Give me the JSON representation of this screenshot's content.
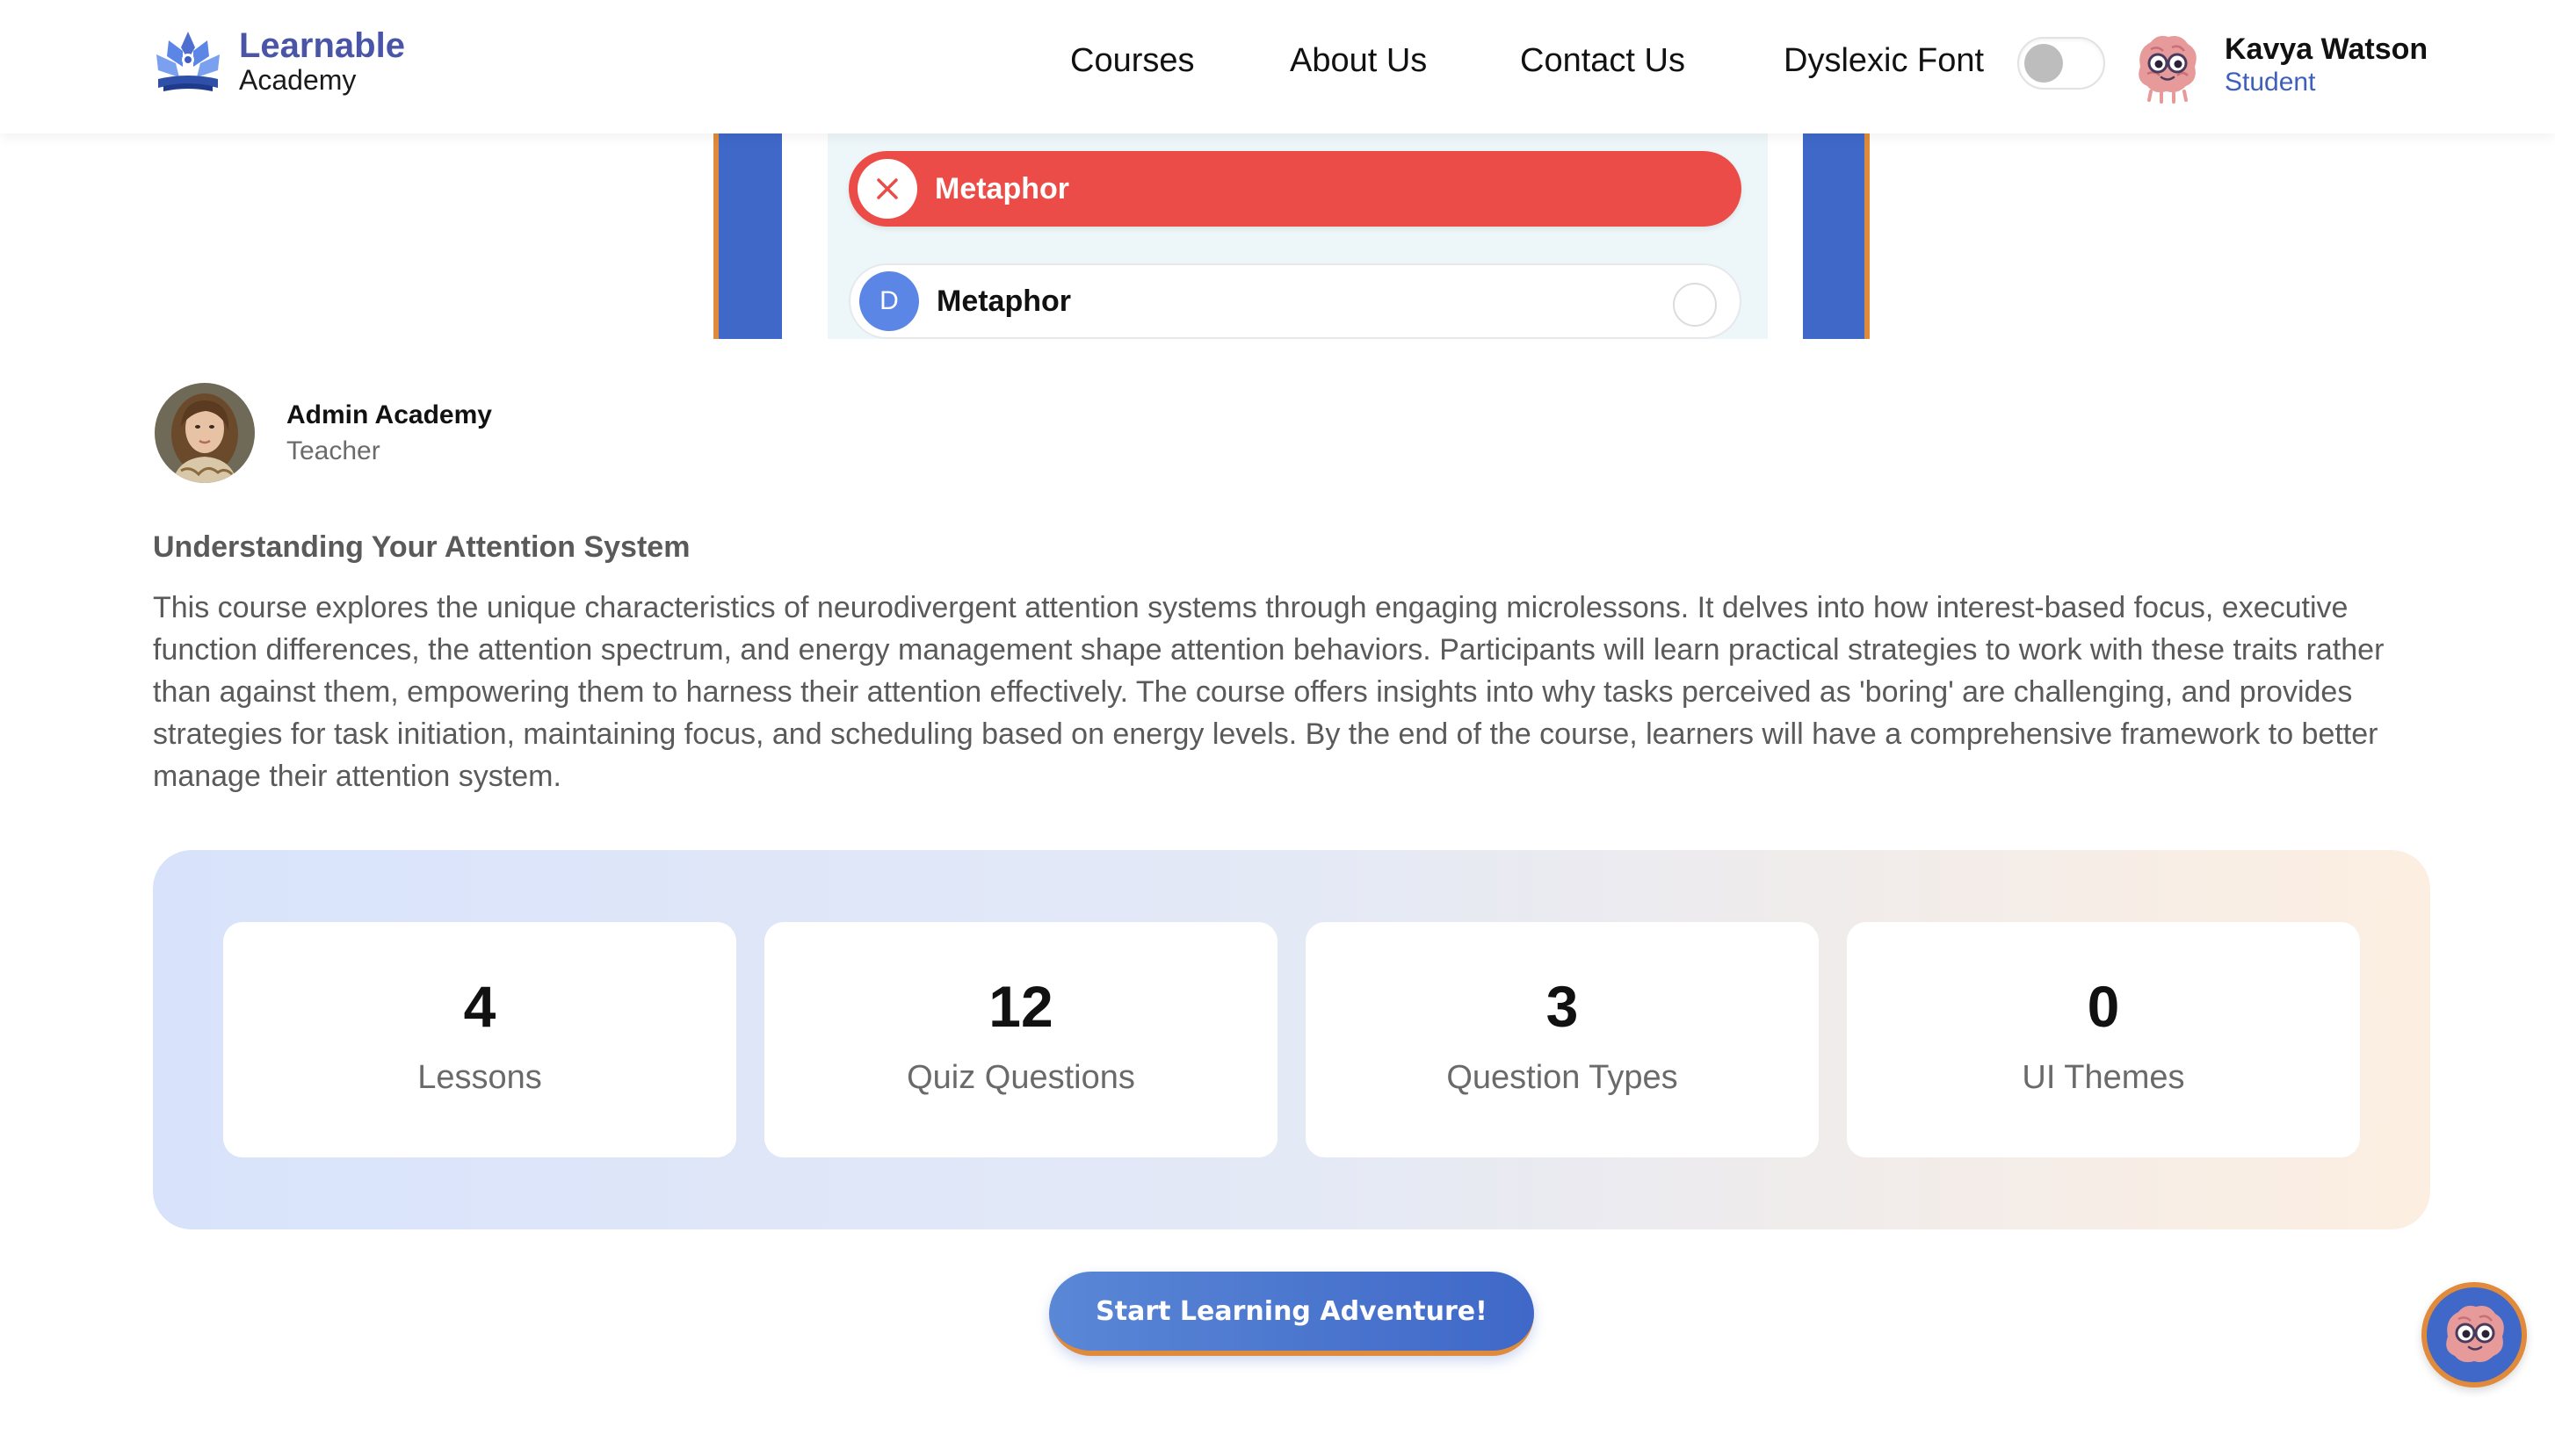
{
  "brand": {
    "name": "Learnable",
    "sub": "Academy"
  },
  "nav": {
    "courses": "Courses",
    "about": "About Us",
    "contact": "Contact Us",
    "dyslexic_font": "Dyslexic Font"
  },
  "user": {
    "name": "Kavya Watson",
    "role": "Student"
  },
  "preview": {
    "options": [
      {
        "badge": "✕",
        "text": "Metaphor",
        "state": "wrong"
      },
      {
        "badge": "D",
        "text": "Metaphor",
        "state": "unselected"
      }
    ]
  },
  "teacher": {
    "name": "Admin Academy",
    "role": "Teacher"
  },
  "course": {
    "title": "Understanding Your Attention System",
    "description": "This course explores the unique characteristics of neurodivergent attention systems through engaging microlessons. It delves into how interest-based focus, executive function differences, the attention spectrum, and energy management shape attention behaviors. Participants will learn practical strategies to work with these traits rather than against them, empowering them to harness their attention effectively. The course offers insights into why tasks perceived as 'boring' are challenging, and provides strategies for task initiation, maintaining focus, and scheduling based on energy levels. By the end of the course, learners will have a comprehensive framework to better manage their attention system."
  },
  "stats": [
    {
      "value": "4",
      "label": "Lessons"
    },
    {
      "value": "12",
      "label": "Quiz Questions"
    },
    {
      "value": "3",
      "label": "Question Types"
    },
    {
      "value": "0",
      "label": "UI Themes"
    }
  ],
  "cta": {
    "label": "Start Learning Adventure!"
  },
  "colors": {
    "primary": "#3f68c8",
    "accent": "#e08a3c",
    "wrong": "#eb4c47"
  },
  "icons": {
    "logo": "lotus-book-icon",
    "avatar": "brain-mascot-icon",
    "wrong": "close-icon"
  }
}
